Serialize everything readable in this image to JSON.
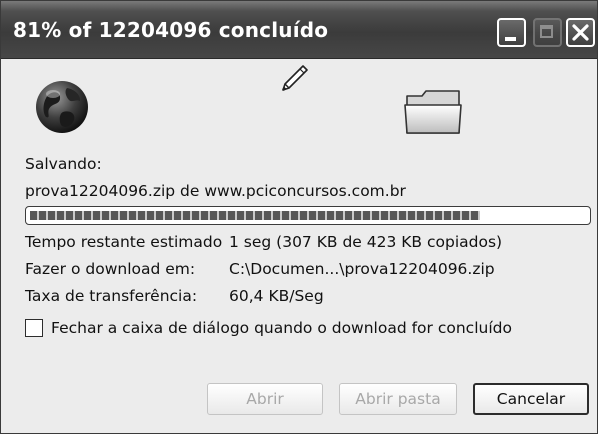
{
  "window": {
    "title": "81% of 12204096 concluído"
  },
  "titlebar_buttons": {
    "minimize": "minimize-icon",
    "maximize": "maximize-icon",
    "close": "close-icon"
  },
  "icons": {
    "globe": "globe-icon",
    "pen": "pen-icon",
    "folder": "folder-icon"
  },
  "download": {
    "saving_label": "Salvando:",
    "file_source": "prova12204096.zip de www.pciconcursos.com.br",
    "progress_percent": 81
  },
  "details": {
    "time_remaining_label": "Tempo restante estimado",
    "time_remaining_value": "1 seg (307 KB de 423 KB copiados)",
    "download_to_label": "Fazer o download em:",
    "download_to_value": "C:\\Documen...\\prova12204096.zip",
    "transfer_rate_label": "Taxa de transferência:",
    "transfer_rate_value": "60,4 KB/Seg"
  },
  "options": {
    "close_on_complete_label": "Fechar a caixa de diálogo quando o download for concluído",
    "close_on_complete_checked": false
  },
  "buttons": {
    "open_label": "Abrir",
    "open_folder_label": "Abrir pasta",
    "cancel_label": "Cancelar"
  }
}
